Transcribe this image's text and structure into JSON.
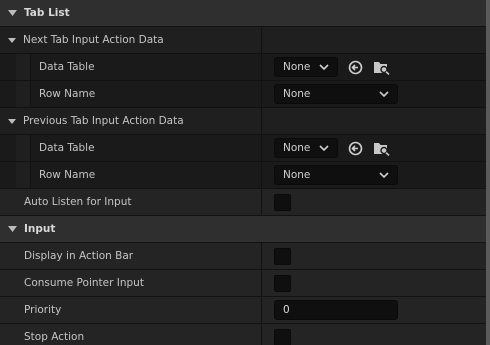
{
  "colors": {
    "background": "#1a1a1a",
    "category_header": "#2f2f2f",
    "row": "#242424",
    "field": "#0f0f0f",
    "text": "#c4c4c4"
  },
  "sections": {
    "tab_list": {
      "title": "Tab List",
      "next_tab": {
        "label": "Next Tab Input Action Data",
        "data_table_label": "Data Table",
        "data_table_value": "None",
        "row_name_label": "Row Name",
        "row_name_value": "None"
      },
      "previous_tab": {
        "label": "Previous Tab Input Action Data",
        "data_table_label": "Data Table",
        "data_table_value": "None",
        "row_name_label": "Row Name",
        "row_name_value": "None"
      },
      "auto_listen": {
        "label": "Auto Listen for Input",
        "checked": false
      }
    },
    "input": {
      "title": "Input",
      "display_in_action_bar": {
        "label": "Display in Action Bar",
        "checked": false
      },
      "consume_pointer_input": {
        "label": "Consume Pointer Input",
        "checked": false
      },
      "priority": {
        "label": "Priority",
        "value": "0"
      },
      "stop_action": {
        "label": "Stop Action",
        "checked": false
      }
    }
  },
  "icons": {
    "category_arrow": "expanded-triangle-icon",
    "browse": "browse-to-asset-icon",
    "find": "find-in-content-browser-icon"
  }
}
